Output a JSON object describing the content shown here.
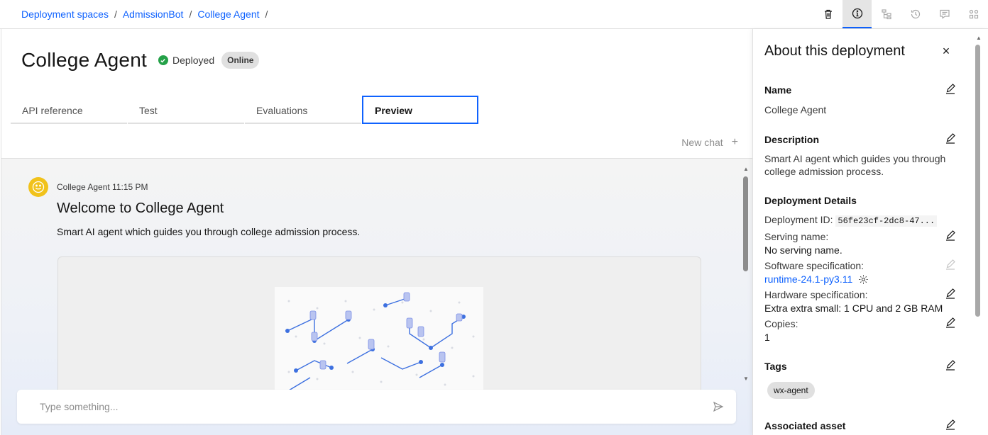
{
  "breadcrumbs": [
    "Deployment spaces",
    "AdmissionBot",
    "College Agent"
  ],
  "breadcrumb_separator": "/",
  "toolbar": {
    "icons": [
      "trash-icon",
      "info-icon",
      "tree-icon",
      "history-icon",
      "chat-icon",
      "apps-icon"
    ],
    "active": "info-icon"
  },
  "header": {
    "title": "College Agent",
    "status": "Deployed",
    "badge": "Online"
  },
  "tabs": [
    {
      "label": "API reference",
      "selected": false
    },
    {
      "label": "Test",
      "selected": false
    },
    {
      "label": "Evaluations",
      "selected": false
    },
    {
      "label": "Preview",
      "selected": true
    }
  ],
  "chat": {
    "new_chat_label": "New chat",
    "new_chat_icon": "+",
    "message": {
      "sender_time": "College Agent 11:15 PM",
      "title": "Welcome to College Agent",
      "body": "Smart AI agent which guides you through college admission process."
    },
    "input_placeholder": "Type something..."
  },
  "panel": {
    "title": "About this deployment",
    "close_icon": "×",
    "name_label": "Name",
    "name_value": "College Agent",
    "description_label": "Description",
    "description_value": "Smart AI agent which guides you through college admission process.",
    "details_label": "Deployment Details",
    "deployment_id_label": "Deployment ID:",
    "deployment_id_value": "56fe23cf-2dc8-47...",
    "serving_name_label": "Serving name:",
    "serving_name_value": "No serving name.",
    "software_spec_label": "Software specification:",
    "software_spec_value": "runtime-24.1-py3.11",
    "hardware_spec_label": "Hardware specification:",
    "hardware_spec_value": "Extra extra small: 1 CPU and 2 GB RAM",
    "copies_label": "Copies:",
    "copies_value": "1",
    "tags_label": "Tags",
    "tag_value": "wx-agent",
    "associated_asset_label": "Associated asset"
  },
  "colors": {
    "accent": "#0f62fe",
    "success": "#24a148",
    "avatar": "#f1c21b"
  }
}
